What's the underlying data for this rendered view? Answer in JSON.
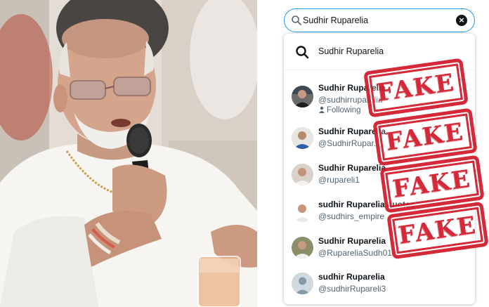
{
  "search": {
    "value": "Sudhir Ruparelia",
    "clear_label": "×"
  },
  "dropdown": {
    "query_suggestion": "Sudhir Ruparelia",
    "results": [
      {
        "name": "Sudhir Ruparelia",
        "handle": "@sudhirruparelia",
        "status": "Following"
      },
      {
        "name": "Sudhir Ruparelia",
        "handle": "@SudhirRupar..."
      },
      {
        "name": "Sudhir Ruparelia",
        "handle": "@rupareli1"
      },
      {
        "name": "sudhir Ruparelia quotes",
        "handle": "@sudhirs_empire"
      },
      {
        "name": "Sudhir Ruparelia",
        "handle": "@RupareliaSudh01"
      },
      {
        "name": "sudhir Ruparelia",
        "handle": "@sudhirRupareli3"
      }
    ]
  },
  "stamps": [
    "FAKE",
    "FAKE",
    "FAKE",
    "FAKE"
  ],
  "colors": {
    "accent": "#1d9bf0",
    "stamp": "#d1192a",
    "text": "#0f1419",
    "secondary_text": "#536471"
  },
  "icons": {
    "search": "search-icon",
    "clear": "close-icon",
    "following": "person-icon"
  }
}
